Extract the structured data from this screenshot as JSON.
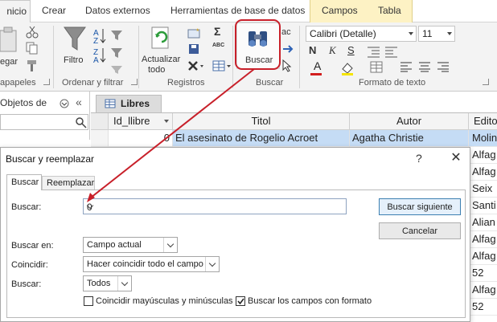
{
  "ribbon_tabs": {
    "inicio": "nicio",
    "crear": "Crear",
    "externos": "Datos externos",
    "herramientas": "Herramientas de base de datos",
    "campos": "Campos",
    "tabla": "Tabla"
  },
  "ribbon": {
    "pegar_label": "egar",
    "portapapeles_label": "apapeles",
    "filtro_label": "Filtro",
    "ordenar_group": "Ordenar y filtrar",
    "actualizar_line1": "Actualizar",
    "actualizar_line2": "todo",
    "registros_group": "Registros",
    "buscar_label": "Buscar",
    "buscar_group": "Buscar",
    "font_name": "Calibri (Detalle)",
    "font_size": "11",
    "formato_group": "Formato de texto",
    "bold": "N",
    "italic": "K",
    "underline": "S",
    "font_color_letter": "A",
    "sigma": "Σ",
    "spell": "ABC",
    "collapse": "«",
    "ac_fragment": "ac"
  },
  "navpane": {
    "header": "Objetos de"
  },
  "table": {
    "tab_label": "Libres",
    "columns": [
      "Id_llibre",
      "Titol",
      "Autor",
      "Edito"
    ],
    "first_row": {
      "id": "0",
      "titol": "El asesinato de Rogelio Acroet",
      "autor": "Agatha Christie",
      "editorial": "Molin"
    },
    "editorial_rest": [
      "Alfag",
      "Alfag",
      "Seix",
      "Santi",
      "Alian",
      "Alfag",
      "Alfag",
      "52",
      "Alfag",
      "52"
    ]
  },
  "dialog": {
    "title": "Buscar y reemplazar",
    "help": "?",
    "close": "✕",
    "tab_buscar": "Buscar",
    "tab_reemplazar": "Reemplazar",
    "find_label": "Buscar:",
    "find_value": "0",
    "look_in_label": "Buscar en:",
    "look_in_value": "Campo actual",
    "match_label": "Coincidir:",
    "match_value": "Hacer coincidir todo el campo",
    "search_label": "Buscar:",
    "search_value": "Todos",
    "find_next": "Buscar siguiente",
    "cancel": "Cancelar",
    "match_case": "Coincidir mayúsculas y minúsculas",
    "match_case_checked": false,
    "search_formatted": "Buscar los campos con formato",
    "search_formatted_checked": true
  },
  "colors": {
    "highlight": "#c8202a",
    "campos_tab": "#fdf2c4",
    "selected_row": "#c5dcf5"
  }
}
